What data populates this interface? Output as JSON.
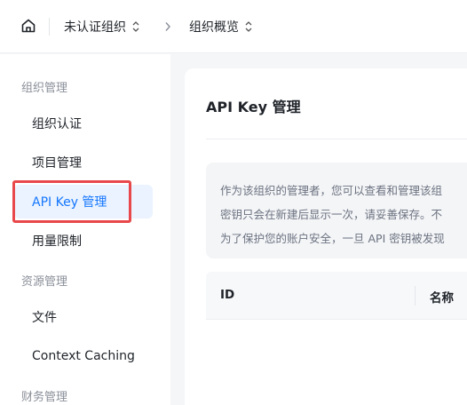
{
  "header": {
    "org_name": "未认证组织",
    "page_switch": "组织概览"
  },
  "sidebar": {
    "sections": [
      {
        "title": "组织管理",
        "items": [
          {
            "label": "组织认证"
          },
          {
            "label": "项目管理"
          },
          {
            "label": "API Key 管理",
            "active": true
          },
          {
            "label": "用量限制"
          }
        ]
      },
      {
        "title": "资源管理",
        "items": [
          {
            "label": "文件"
          },
          {
            "label": "Context Caching"
          }
        ]
      },
      {
        "title": "财务管理",
        "items": []
      }
    ]
  },
  "main": {
    "title": "API Key 管理",
    "notice_lines": [
      "作为该组织的管理者，您可以查看和管理该组",
      "密钥只会在新建后显示一次，请妥善保存。不",
      "为了保护您的账户安全，一旦 API 密钥被发现"
    ],
    "table": {
      "columns": [
        "ID",
        "名称"
      ]
    }
  },
  "colors": {
    "accent": "#1677ff",
    "active_bg": "#eaf3ff",
    "highlight": "#e8484b",
    "page_bg": "#f5f6f8"
  },
  "icons": {
    "home": "home-icon",
    "org_switch": "chevron-up-down-icon",
    "breadcrumb": "chevron-right-icon"
  }
}
